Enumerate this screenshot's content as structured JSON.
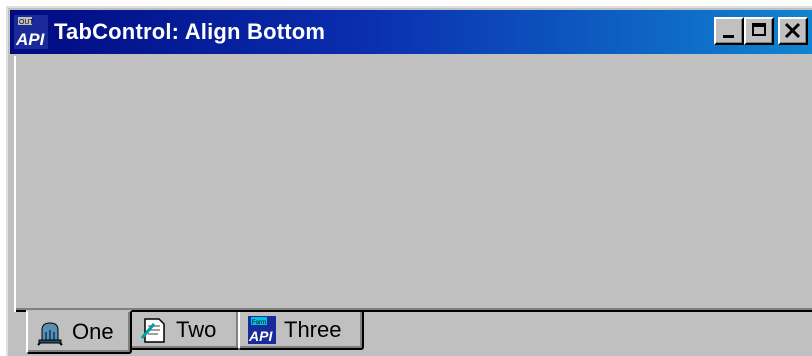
{
  "window": {
    "title": "TabControl: Align Bottom",
    "icon": "api-app-icon",
    "buttons": [
      "minimize",
      "maximize",
      "close"
    ]
  },
  "tabs": [
    {
      "label": "One",
      "icon": "bell-icon",
      "selected": true
    },
    {
      "label": "Two",
      "icon": "document-icon",
      "selected": false
    },
    {
      "label": "Three",
      "icon": "api-icon",
      "selected": false
    }
  ],
  "colors": {
    "titlebar_start": "#000a80",
    "titlebar_end": "#1084d0",
    "face": "#c0c0c0"
  }
}
